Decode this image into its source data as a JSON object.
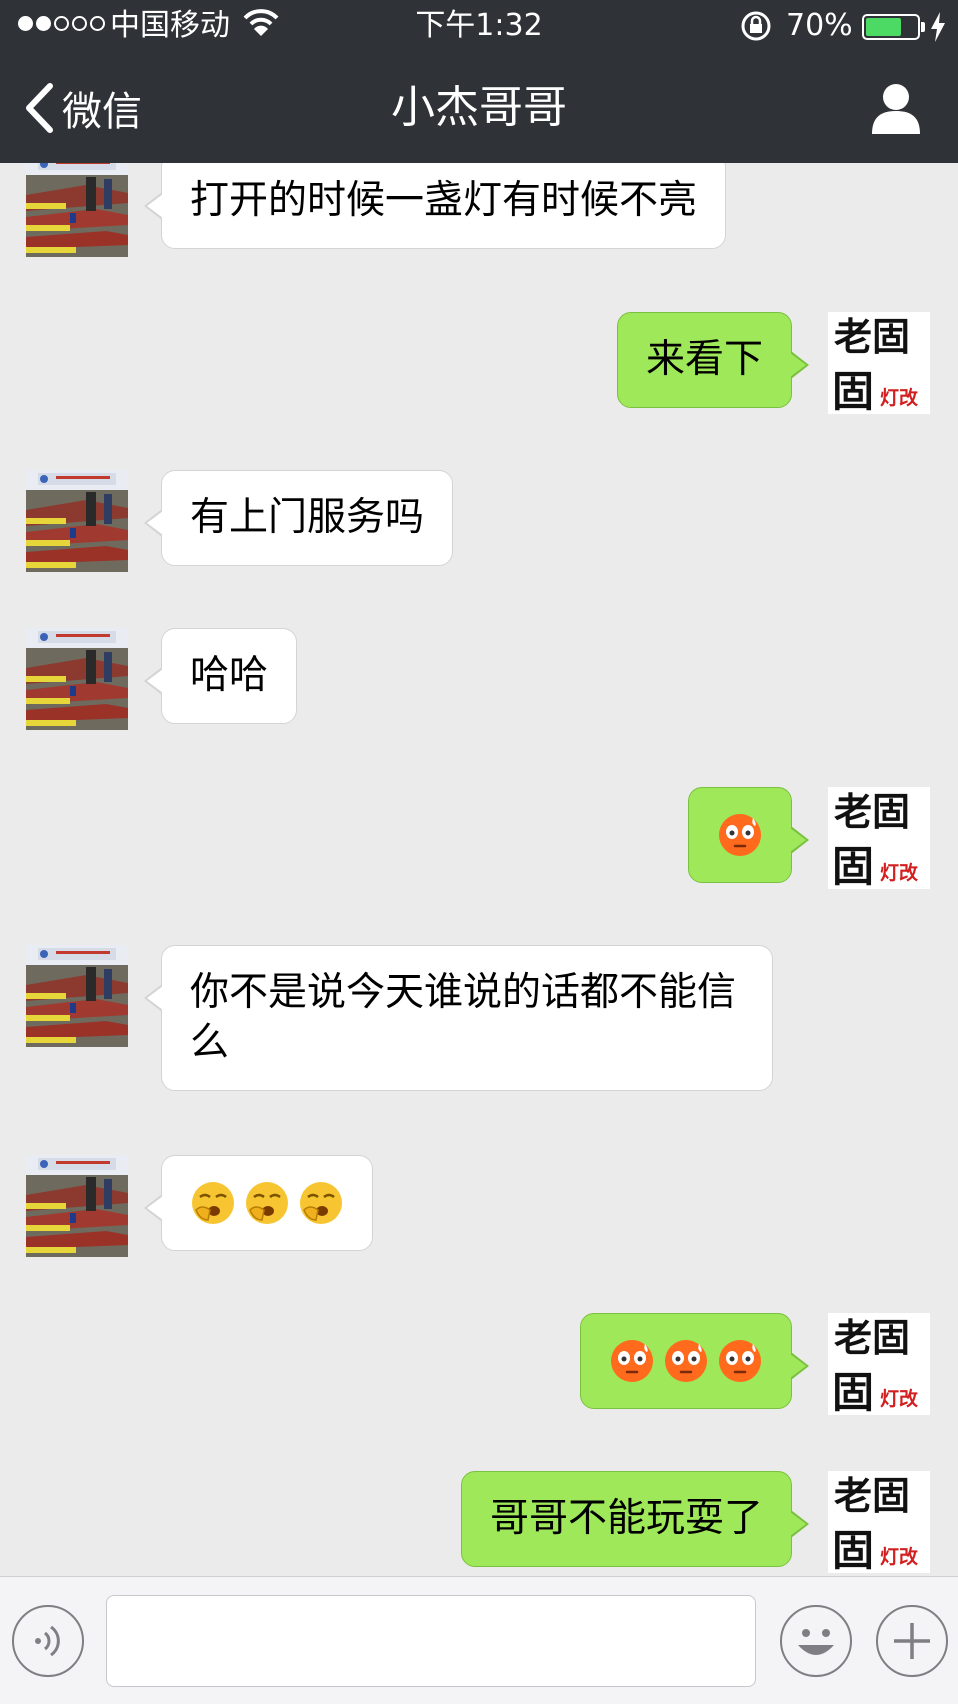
{
  "status_bar": {
    "carrier": "中国移动",
    "time": "下午1:32",
    "battery_percent": "70%",
    "battery_level": 0.7,
    "signal_bars_filled": 2,
    "signal_bars_total": 5
  },
  "nav": {
    "back_label": "微信",
    "title": "小杰哥哥"
  },
  "messages": [
    {
      "sender": "peer",
      "type": "text",
      "text": "打开的时候一盏灯有时候不亮"
    },
    {
      "sender": "me",
      "type": "text",
      "text": "来看下"
    },
    {
      "sender": "peer",
      "type": "text",
      "text": "有上门服务吗"
    },
    {
      "sender": "peer",
      "type": "text",
      "text": "哈哈"
    },
    {
      "sender": "me",
      "type": "emoji",
      "emoji": "flushed-face",
      "count": 1
    },
    {
      "sender": "peer",
      "type": "text",
      "text": "你不是说今天谁说的话都不能信么"
    },
    {
      "sender": "peer",
      "type": "emoji",
      "emoji": "yawning-face",
      "count": 3
    },
    {
      "sender": "me",
      "type": "emoji",
      "emoji": "flushed-face",
      "count": 3
    },
    {
      "sender": "me",
      "type": "text",
      "text": "哥哥不能玩耍了"
    }
  ],
  "my_avatar": {
    "logo_text": "老固",
    "logo_subtext": "灯改"
  },
  "input_bar": {
    "value": ""
  },
  "colors": {
    "nav_bg": "#2f3236",
    "chat_bg": "#ebebeb",
    "my_bubble": "#9fe859",
    "peer_bubble": "#ffffff",
    "battery": "#4cd964"
  }
}
